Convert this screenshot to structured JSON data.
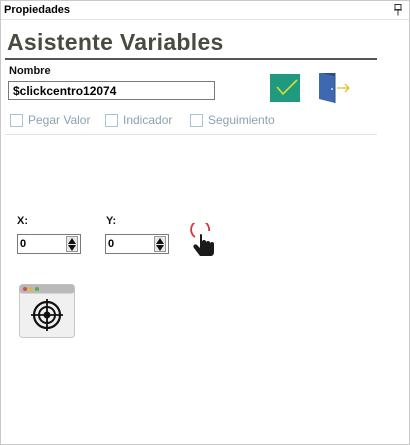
{
  "panel": {
    "title": "Propiedades"
  },
  "wizard": {
    "heading": "Asistente Variables",
    "name_label": "Nombre",
    "name_value": "$clickcentro12074",
    "options": [
      {
        "label": "Pegar Valor",
        "checked": false
      },
      {
        "label": "Indicador",
        "checked": false
      },
      {
        "label": "Seguimiento",
        "checked": false
      }
    ],
    "x_label": "X:",
    "x_value": "0",
    "y_label": "Y:",
    "y_value": "0"
  },
  "colors": {
    "accept_button": "#1f9a7e",
    "exit_door": "#3e68b0",
    "heading": "#4a4a40",
    "checkbox_label": "#8aa3af"
  },
  "icons": [
    "pin-icon",
    "checkmark-icon",
    "exit-door-icon",
    "click-hand-icon",
    "target-window-icon"
  ]
}
